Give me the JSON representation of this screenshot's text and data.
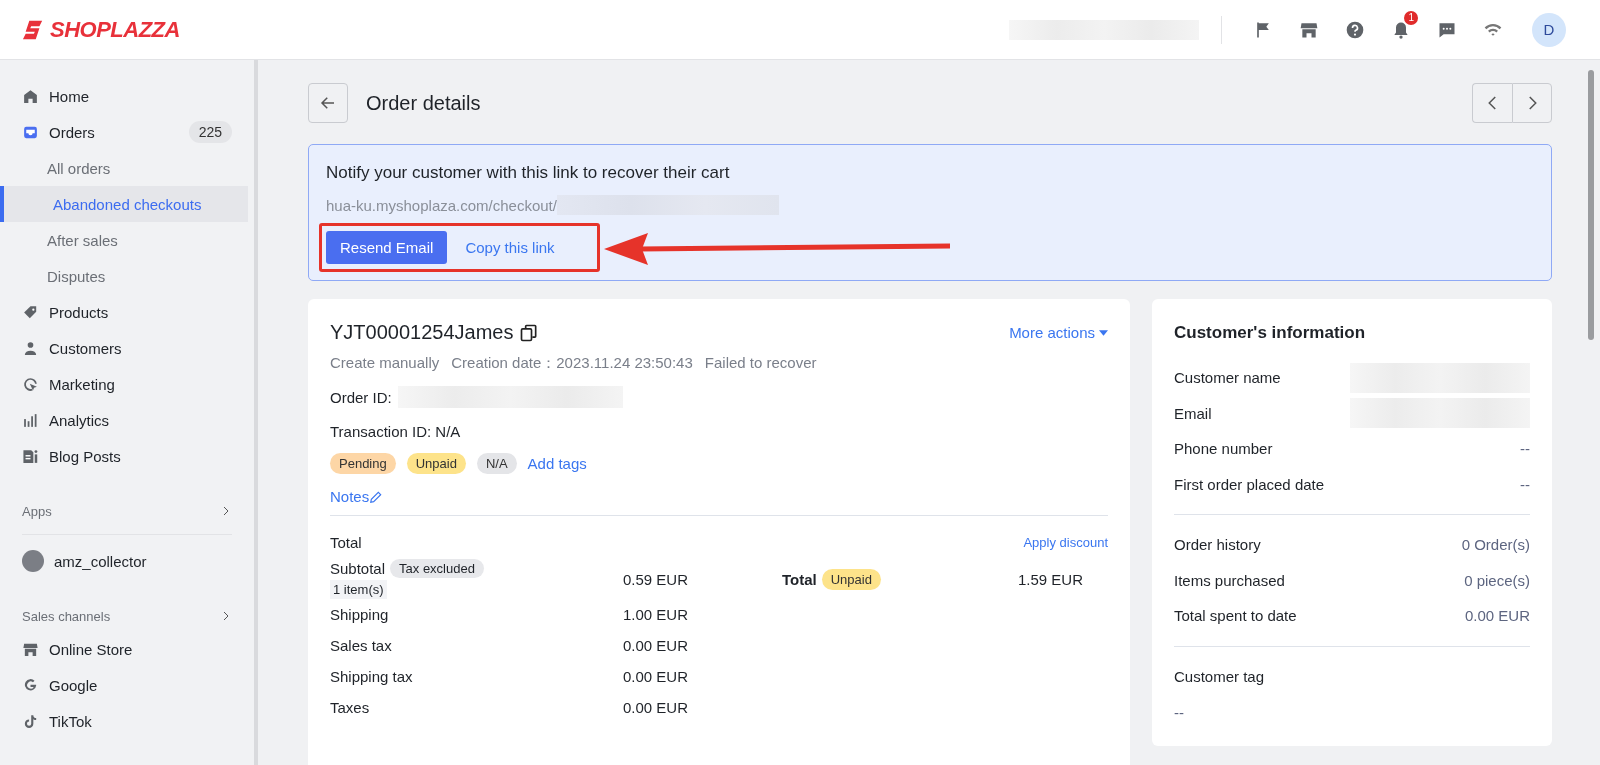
{
  "header": {
    "logo": "SHOPLAZZA",
    "notification_count": "1",
    "avatar": "D"
  },
  "sidebar": {
    "items": [
      {
        "label": "Home",
        "selected": false
      },
      {
        "label": "Orders",
        "selected": false,
        "badge": "225",
        "expanded": true,
        "children": [
          {
            "label": "All orders",
            "selected": false
          },
          {
            "label": "Abandoned checkouts",
            "selected": true
          },
          {
            "label": "After sales",
            "selected": false
          },
          {
            "label": "Disputes",
            "selected": false
          }
        ]
      },
      {
        "label": "Products",
        "selected": false
      },
      {
        "label": "Customers",
        "selected": false
      },
      {
        "label": "Marketing",
        "selected": false
      },
      {
        "label": "Analytics",
        "selected": false
      },
      {
        "label": "Blog Posts",
        "selected": false
      }
    ],
    "apps_heading": "Apps",
    "apps": [
      {
        "label": "amz_collector",
        "selected": false
      }
    ],
    "channels_heading": "Sales channels",
    "channels": [
      {
        "label": "Online Store",
        "selected": false
      },
      {
        "label": "Google",
        "selected": false
      },
      {
        "label": "TikTok",
        "selected": false
      }
    ]
  },
  "page": {
    "title": "Order details"
  },
  "banner": {
    "title": "Notify your customer with this link to recover their cart",
    "link": "hua-ku.myshoplaza.com/checkout/",
    "buttons": [
      {
        "label": "Resend Email",
        "kind": "primary"
      },
      {
        "label": "Copy this link",
        "kind": "link"
      }
    ]
  },
  "order": {
    "number": "YJT00001254James",
    "more_actions": "More actions",
    "meta": [
      "Create manually",
      "Creation date：2023.11.24 23:50:43",
      "Failed to recover"
    ],
    "order_id_label": "Order ID:",
    "transaction": "Transaction ID: N/A",
    "tags": [
      {
        "label": "Pending",
        "color": "#fdd6a6"
      },
      {
        "label": "Unpaid",
        "color": "#fde38a"
      },
      {
        "label": "N/A",
        "color": "#e4e5e8"
      }
    ],
    "add_tags": "Add tags",
    "notes": "Notes",
    "totals": {
      "heading": "Total",
      "apply_discount": "Apply discount",
      "subtotal": {
        "label": "Subtotal",
        "badge": "Tax excluded",
        "items": "1 item(s)",
        "value": "0.59 EUR"
      },
      "lines": [
        {
          "label": "Shipping",
          "value": "1.00 EUR"
        },
        {
          "label": "Sales tax",
          "value": "0.00 EUR"
        },
        {
          "label": "Shipping tax",
          "value": "0.00 EUR"
        },
        {
          "label": "Taxes",
          "value": "0.00 EUR"
        }
      ],
      "total": {
        "label": "Total",
        "badge": "Unpaid",
        "value": "1.59 EUR"
      }
    }
  },
  "customer": {
    "title": "Customer's information",
    "groups": [
      [
        {
          "label": "Customer name",
          "kind": "hidden"
        },
        {
          "label": "Email",
          "kind": "hidden"
        },
        {
          "label": "Phone number",
          "value": "--",
          "kind": "text"
        },
        {
          "label": "First order placed date",
          "value": "--",
          "kind": "text"
        }
      ],
      [
        {
          "label": "Order history",
          "value": "0 Order(s)",
          "kind": "text"
        },
        {
          "label": "Items purchased",
          "value": "0 piece(s)",
          "kind": "text"
        },
        {
          "label": "Total spent to date",
          "value": "0.00 EUR",
          "kind": "text"
        }
      ]
    ],
    "tag_label": "Customer tag",
    "tag_value": "--"
  }
}
